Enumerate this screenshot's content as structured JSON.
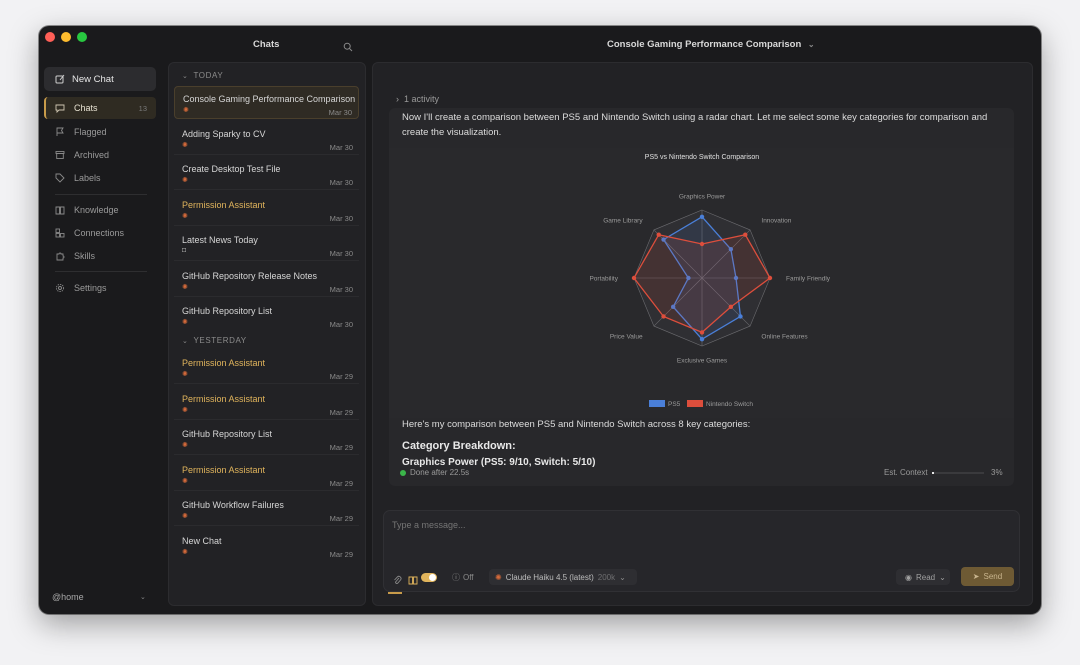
{
  "sidebar": {
    "new_chat": "New Chat",
    "items": [
      {
        "label": "Chats",
        "count": "13"
      },
      {
        "label": "Flagged"
      },
      {
        "label": "Archived"
      },
      {
        "label": "Labels"
      },
      {
        "label": "Knowledge"
      },
      {
        "label": "Connections"
      },
      {
        "label": "Skills"
      },
      {
        "label": "Settings"
      }
    ],
    "workspace": "@home"
  },
  "list": {
    "title": "Chats",
    "sections": {
      "today": "TODAY",
      "yesterday": "YESTERDAY"
    },
    "items": [
      {
        "title": "Console Gaming Performance Comparison",
        "date": "Mar 30",
        "amber": false
      },
      {
        "title": "Adding Sparky to CV",
        "date": "Mar 30",
        "amber": false
      },
      {
        "title": "Create Desktop Test File",
        "date": "Mar 30",
        "amber": false
      },
      {
        "title": "Permission Assistant",
        "date": "Mar 30",
        "amber": true
      },
      {
        "title": "Latest News Today",
        "date": "Mar 30",
        "amber": false
      },
      {
        "title": "GitHub Repository Release Notes",
        "date": "Mar 30",
        "amber": false
      },
      {
        "title": "GitHub Repository List",
        "date": "Mar 30",
        "amber": false
      },
      {
        "title": "Permission Assistant",
        "date": "Mar 29",
        "amber": true
      },
      {
        "title": "Permission Assistant",
        "date": "Mar 29",
        "amber": true
      },
      {
        "title": "GitHub Repository List",
        "date": "Mar 29",
        "amber": false
      },
      {
        "title": "Permission Assistant",
        "date": "Mar 29",
        "amber": true
      },
      {
        "title": "GitHub Workflow Failures",
        "date": "Mar 29",
        "amber": false
      },
      {
        "title": "New Chat",
        "date": "Mar 29",
        "amber": false
      }
    ]
  },
  "main": {
    "title": "Console Gaming Performance Comparison",
    "activity": "1 activity",
    "intro": "Now I'll create a comparison between PS5 and Nintendo Switch using a radar chart. Let me select some key categories for comparison and create the visualization.",
    "summary": "Here's my comparison between PS5 and Nintendo Switch across 8 key categories:",
    "heading": "Category Breakdown:",
    "cut_line": "Graphics Power (PS5: 9/10, Switch: 5/10)",
    "done": "Done after 22.5s",
    "est_context": "Est. Context",
    "est_pct": "3%",
    "context_fraction": 0.03
  },
  "composer": {
    "placeholder": "Type a message...",
    "off": "Off",
    "model": "Claude Haiku 4.5 (latest)",
    "model_tokens": "200k",
    "read": "Read",
    "send": "Send"
  },
  "colors": {
    "ps5": "#4a7fd8",
    "switch": "#dd4e3c",
    "accent": "#c89b4a"
  },
  "chart_data": {
    "type": "radar",
    "title": "PS5 vs Nintendo Switch Comparison",
    "categories": [
      "Graphics Power",
      "Innovation",
      "Family Friendly",
      "Online Features",
      "Exclusive Games",
      "Price Value",
      "Portability",
      "Game Library"
    ],
    "series": [
      {
        "name": "PS5",
        "values": [
          9,
          6,
          5,
          8,
          9,
          6,
          2,
          8
        ]
      },
      {
        "name": "Nintendo Switch",
        "values": [
          5,
          9,
          10,
          6,
          8,
          8,
          10,
          9
        ]
      }
    ],
    "range": [
      0,
      10
    ]
  }
}
